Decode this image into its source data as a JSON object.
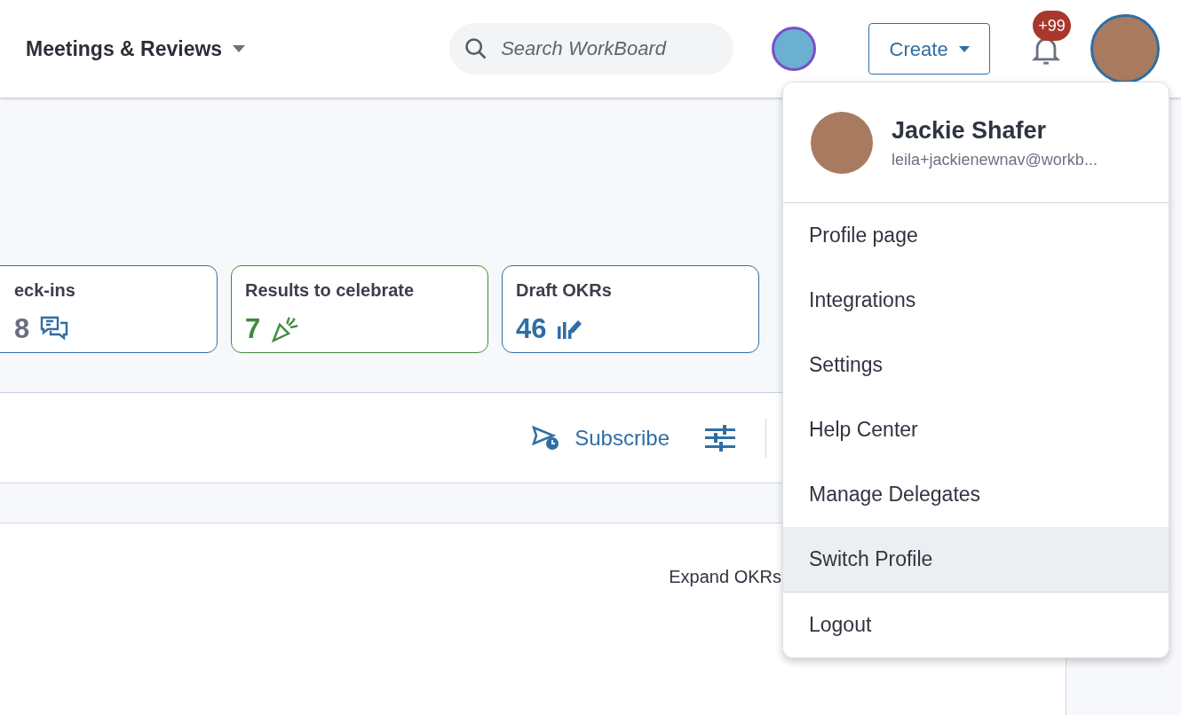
{
  "header": {
    "title": "Meetings & Reviews",
    "search": {
      "placeholder": "Search WorkBoard"
    },
    "create_button": "Create",
    "notifications_badge": "+99"
  },
  "stat_cards": [
    {
      "kind": "checkins",
      "title": "eck-ins",
      "value": "8",
      "color": "#2f6ea5"
    },
    {
      "kind": "celebrate",
      "title": "Results to celebrate",
      "value": "7",
      "color": "#3f8a3a"
    },
    {
      "kind": "draft",
      "title": "Draft OKRs",
      "value": "46",
      "color": "#2f6ea5"
    }
  ],
  "toolbar": {
    "subscribe": "Subscribe"
  },
  "expand_label": "Expand OKRs",
  "profile_menu": {
    "name": "Jackie Shafer",
    "email": "leila+jackienewnav@workb...",
    "items": [
      {
        "label": "Profile page",
        "highlighted": false,
        "divider_before": false
      },
      {
        "label": "Integrations",
        "highlighted": false,
        "divider_before": false
      },
      {
        "label": "Settings",
        "highlighted": false,
        "divider_before": false
      },
      {
        "label": "Help Center",
        "highlighted": false,
        "divider_before": false
      },
      {
        "label": "Manage Delegates",
        "highlighted": false,
        "divider_before": false
      },
      {
        "label": "Switch Profile",
        "highlighted": true,
        "divider_before": false
      },
      {
        "label": "Logout",
        "highlighted": false,
        "divider_before": true
      }
    ]
  }
}
